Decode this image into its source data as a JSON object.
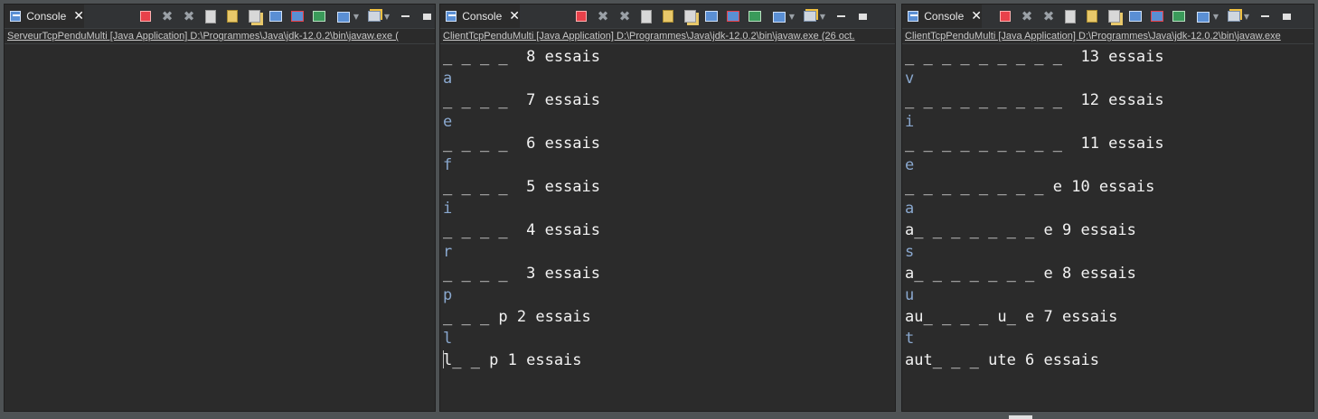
{
  "tab_label": "Console",
  "panels": [
    {
      "header": "ServeurTcpPenduMulti [Java Application] D:\\Programmes\\Java\\jdk-12.0.2\\bin\\javaw.exe (",
      "lines": []
    },
    {
      "header": "ClientTcpPenduMulti [Java Application] D:\\Programmes\\Java\\jdk-12.0.2\\bin\\javaw.exe (26 oct.",
      "lines": [
        {
          "text": "_ _ _ _  8 essais",
          "kind": "out"
        },
        {
          "text": "a",
          "kind": "in"
        },
        {
          "text": "_ _ _ _  7 essais",
          "kind": "out"
        },
        {
          "text": "e",
          "kind": "in"
        },
        {
          "text": "_ _ _ _  6 essais",
          "kind": "out"
        },
        {
          "text": "f",
          "kind": "in"
        },
        {
          "text": "_ _ _ _  5 essais",
          "kind": "out"
        },
        {
          "text": "i",
          "kind": "in"
        },
        {
          "text": "_ _ _ _  4 essais",
          "kind": "out"
        },
        {
          "text": "r",
          "kind": "in"
        },
        {
          "text": "_ _ _ _  3 essais",
          "kind": "out"
        },
        {
          "text": "p",
          "kind": "in"
        },
        {
          "text": "_ _ _ p 2 essais",
          "kind": "out"
        },
        {
          "text": "l",
          "kind": "in"
        },
        {
          "text": "l_ _ p 1 essais",
          "kind": "out"
        }
      ]
    },
    {
      "header": "ClientTcpPenduMulti [Java Application] D:\\Programmes\\Java\\jdk-12.0.2\\bin\\javaw.exe",
      "lines": [
        {
          "text": "_ _ _ _ _ _ _ _ _  13 essais",
          "kind": "out"
        },
        {
          "text": "v",
          "kind": "in"
        },
        {
          "text": "_ _ _ _ _ _ _ _ _  12 essais",
          "kind": "out"
        },
        {
          "text": "i",
          "kind": "in"
        },
        {
          "text": "_ _ _ _ _ _ _ _ _  11 essais",
          "kind": "out"
        },
        {
          "text": "e",
          "kind": "in"
        },
        {
          "text": "_ _ _ _ _ _ _ _ e 10 essais",
          "kind": "out"
        },
        {
          "text": "a",
          "kind": "in"
        },
        {
          "text": "a_ _ _ _ _ _ _ e 9 essais",
          "kind": "out"
        },
        {
          "text": "s",
          "kind": "in"
        },
        {
          "text": "a_ _ _ _ _ _ _ e 8 essais",
          "kind": "out"
        },
        {
          "text": "u",
          "kind": "in"
        },
        {
          "text": "au_ _ _ _ u_ e 7 essais",
          "kind": "out"
        },
        {
          "text": "t",
          "kind": "in"
        },
        {
          "text": "aut_ _ _ ute 6 essais",
          "kind": "out"
        }
      ]
    }
  ],
  "toolbar_icons": [
    "terminate-icon",
    "remove-launch-icon",
    "remove-all-terminated-icon",
    "clear-console-icon",
    "scroll-lock-icon",
    "pin-console-icon",
    "show-on-stdout-icon",
    "show-on-stderr-icon",
    "display-selected-console-icon",
    "open-console-icon",
    "new-console-icon",
    "minimize-icon",
    "maximize-icon"
  ],
  "colors": {
    "background": "#2b2b2b",
    "output": "#f2f2f2",
    "input": "#8aa8cf"
  }
}
